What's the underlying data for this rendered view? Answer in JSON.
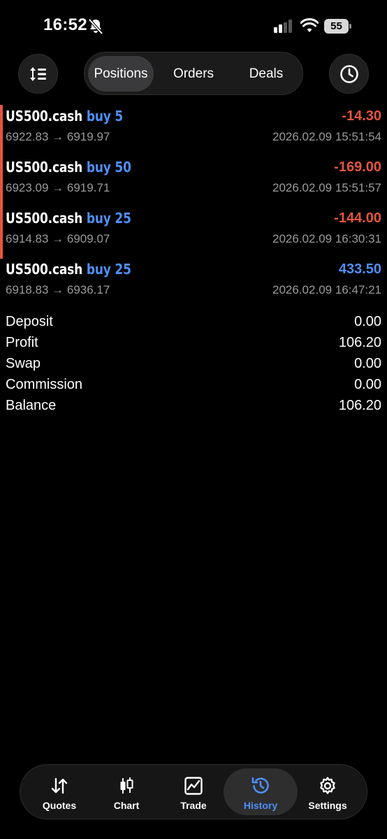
{
  "status_bar": {
    "time": "16:52",
    "battery": "55"
  },
  "segments": [
    {
      "label": "Positions",
      "active": true
    },
    {
      "label": "Orders",
      "active": false
    },
    {
      "label": "Deals",
      "active": false
    }
  ],
  "deals": [
    {
      "symbol": "US500.cash",
      "side": "buy 5",
      "profit": "-14.30",
      "prices": "6922.83 → 6919.97",
      "time": "2026.02.09 15:51:54"
    },
    {
      "symbol": "US500.cash",
      "side": "buy 50",
      "profit": "-169.00",
      "prices": "6923.09 → 6919.71",
      "time": "2026.02.09 15:51:57"
    },
    {
      "symbol": "US500.cash",
      "side": "buy 25",
      "profit": "-144.00",
      "prices": "6914.83 → 6909.07",
      "time": "2026.02.09 16:30:31"
    },
    {
      "symbol": "US500.cash",
      "side": "buy 25",
      "profit": "433.50",
      "prices": "6918.83 → 6936.17",
      "time": "2026.02.09 16:47:21"
    }
  ],
  "summary": [
    {
      "label": "Deposit",
      "value": "0.00"
    },
    {
      "label": "Profit",
      "value": "106.20"
    },
    {
      "label": "Swap",
      "value": "0.00"
    },
    {
      "label": "Commission",
      "value": "0.00"
    },
    {
      "label": "Balance",
      "value": "106.20"
    }
  ],
  "tabs": [
    {
      "label": "Quotes",
      "icon": "quotes-icon"
    },
    {
      "label": "Chart",
      "icon": "chart-icon"
    },
    {
      "label": "Trade",
      "icon": "trade-icon"
    },
    {
      "label": "History",
      "icon": "history-icon",
      "active": true
    },
    {
      "label": "Settings",
      "icon": "settings-icon"
    }
  ],
  "colors": {
    "loss": "#e5553f",
    "gain": "#4f8ff7",
    "muted": "#9a9a9a",
    "background": "#000000"
  }
}
